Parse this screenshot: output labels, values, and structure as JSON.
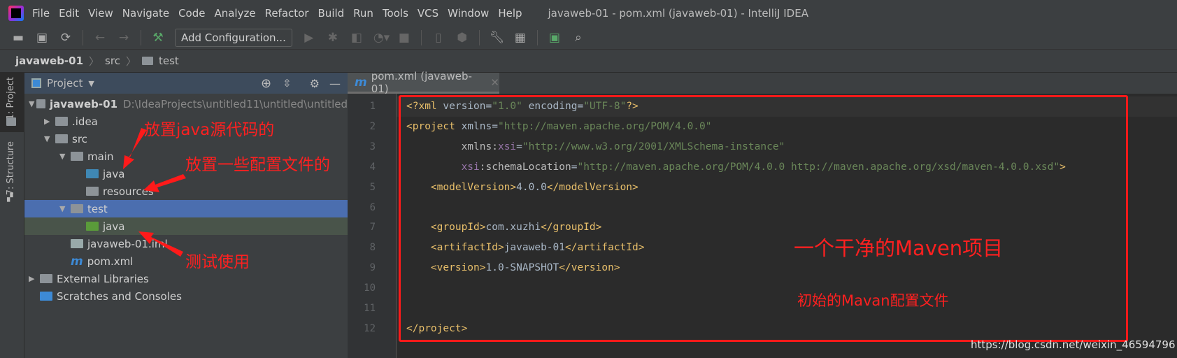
{
  "window": {
    "title": "javaweb-01 - pom.xml (javaweb-01) - IntelliJ IDEA"
  },
  "menu": [
    "File",
    "Edit",
    "View",
    "Navigate",
    "Code",
    "Analyze",
    "Refactor",
    "Build",
    "Run",
    "Tools",
    "VCS",
    "Window",
    "Help"
  ],
  "toolbar": {
    "add_configuration": "Add Configuration..."
  },
  "breadcrumb": [
    "javaweb-01",
    "src",
    "test"
  ],
  "tool_strip": {
    "project": "1: Project",
    "structure": "7: Structure"
  },
  "project_panel": {
    "title": "Project",
    "tree": [
      {
        "label": "javaweb-01",
        "detail": "D:\\IdeaProjects\\untitled11\\untitled\\untitled",
        "depth": 0,
        "expanded": true,
        "icon": "module-folder-icon"
      },
      {
        "label": ".idea",
        "depth": 1,
        "expanded": false,
        "icon": "folder-icon"
      },
      {
        "label": "src",
        "depth": 1,
        "expanded": true,
        "icon": "folder-icon"
      },
      {
        "label": "main",
        "depth": 2,
        "expanded": true,
        "icon": "folder-icon"
      },
      {
        "label": "java",
        "depth": 3,
        "icon": "source-folder-icon"
      },
      {
        "label": "resources",
        "depth": 3,
        "icon": "resources-folder-icon"
      },
      {
        "label": "test",
        "depth": 2,
        "expanded": true,
        "icon": "folder-icon",
        "selected": true
      },
      {
        "label": "java",
        "depth": 3,
        "icon": "test-folder-icon",
        "highlight": true
      },
      {
        "label": "javaweb-01.iml",
        "depth": 2,
        "icon": "iml-file-icon"
      },
      {
        "label": "pom.xml",
        "depth": 2,
        "icon": "maven-icon"
      },
      {
        "label": "External Libraries",
        "depth": 0,
        "expanded": false,
        "icon": "library-icon"
      },
      {
        "label": "Scratches and Consoles",
        "depth": 0,
        "icon": "scratches-icon"
      }
    ]
  },
  "editor": {
    "tab": "pom.xml (javaweb-01)",
    "lines": [
      "<?xml version=\"1.0\" encoding=\"UTF-8\"?>",
      "<project xmlns=\"http://maven.apache.org/POM/4.0.0\"",
      "         xmlns:xsi=\"http://www.w3.org/2001/XMLSchema-instance\"",
      "         xsi:schemaLocation=\"http://maven.apache.org/POM/4.0.0 http://maven.apache.org/xsd/maven-4.0.0.xsd\">",
      "    <modelVersion>4.0.0</modelVersion>",
      "",
      "    <groupId>com.xuzhi</groupId>",
      "    <artifactId>javaweb-01</artifactId>",
      "    <version>1.0-SNAPSHOT</version>",
      "",
      "",
      "</project>"
    ]
  },
  "annotations": {
    "java_src": "放置java源代码的",
    "resources": "放置一些配置文件的",
    "test": "测试使用",
    "clean_maven": "一个干净的Maven项目",
    "initial_config": "初始的Mavan配置文件"
  },
  "watermark": "https://blog.csdn.net/weixin_46594796",
  "colors": {
    "annotation": "#ff1a1a",
    "selection": "#4b6eaf",
    "test_row": "#49544a",
    "editor_bg": "#2b2b2b",
    "tag": "#e8bf6a",
    "string": "#6a8759"
  }
}
